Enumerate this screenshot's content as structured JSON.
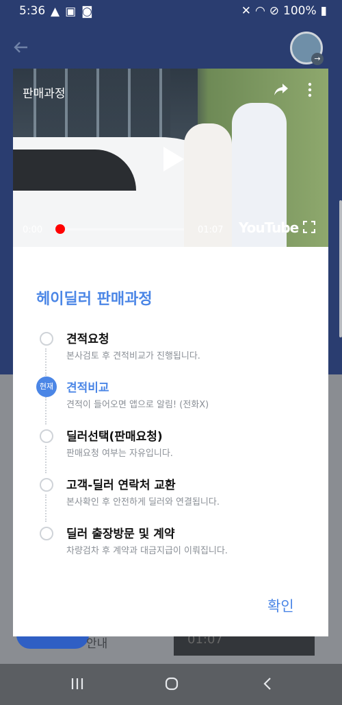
{
  "status_bar": {
    "time": "5:36",
    "battery": "100%"
  },
  "video": {
    "title": "판매과정",
    "current_time": "0:00",
    "duration": "01:07",
    "brand": "YouTube",
    "progress": 0.0
  },
  "dialog": {
    "heading": "헤이딜러 판매과정",
    "current_badge": "현재",
    "steps": [
      {
        "title": "견적요청",
        "desc": "본사검토 후 견적비교가 진행됩니다.",
        "current": false
      },
      {
        "title": "견적비교",
        "desc": "견적이 들어오면 앱으로 알림! (전화X)",
        "current": true
      },
      {
        "title": "딜러선택(판매요청)",
        "desc": "판매요청 여부는 자유입니다.",
        "current": false
      },
      {
        "title": "고객-딜러 연락처 교환",
        "desc": "본사확인 후 안전하게 딜러와 연결됩니다.",
        "current": false
      },
      {
        "title": "딜러 출장방문 및 계약",
        "desc": "차량검차 후 계약과 대금지급이 이뤄집니다.",
        "current": false
      }
    ],
    "confirm_label": "확인"
  },
  "background": {
    "button_text": "안내",
    "thumb_time": "01:07"
  },
  "colors": {
    "accent": "#4b86e6",
    "header": "#2a3d70"
  }
}
